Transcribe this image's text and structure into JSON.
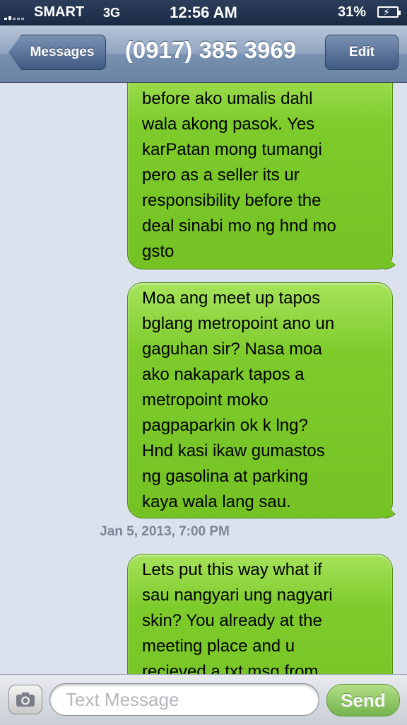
{
  "status_bar": {
    "carrier": "SMART",
    "network": "3G",
    "time": "12:56 AM",
    "battery": "31%",
    "icons": [
      "signal-icon",
      "battery-charging-icon"
    ]
  },
  "nav": {
    "back_label": "Messages",
    "title": "(0917) 385 3969",
    "edit_label": "Edit"
  },
  "messages": [
    {
      "text": "before ako umalis dahl\nwala akong pasok. Yes\nkarPatan mong tumangi\npero as a seller its ur\nresponsibility before the\ndeal sinabi mo ng hnd mo\ngsto"
    },
    {
      "text": "Moa ang meet up tapos\nbglang metropoint ano un\ngaguhan sir? Nasa moa\nako nakapark tapos a\nmetropoint moko\npagpaparkin ok k lng?\nHnd kasi ikaw gumastos\nng gasolina at parking\nkaya wala lang sau."
    },
    {
      "text": "Lets put this way what if\nsau nangyari ung nagyari\nskin? You already at the\nmeeting place and u\nrecieved a txt msg from"
    }
  ],
  "timestamp": "Jan 5, 2013, 7:00 PM",
  "input": {
    "placeholder": "Text Message",
    "value": "",
    "send_label": "Send",
    "camera_icon": "camera-icon"
  },
  "colors": {
    "bubble_green": "#7ecb2c",
    "background": "#dbe2ed",
    "navbar": "#7890b0"
  }
}
